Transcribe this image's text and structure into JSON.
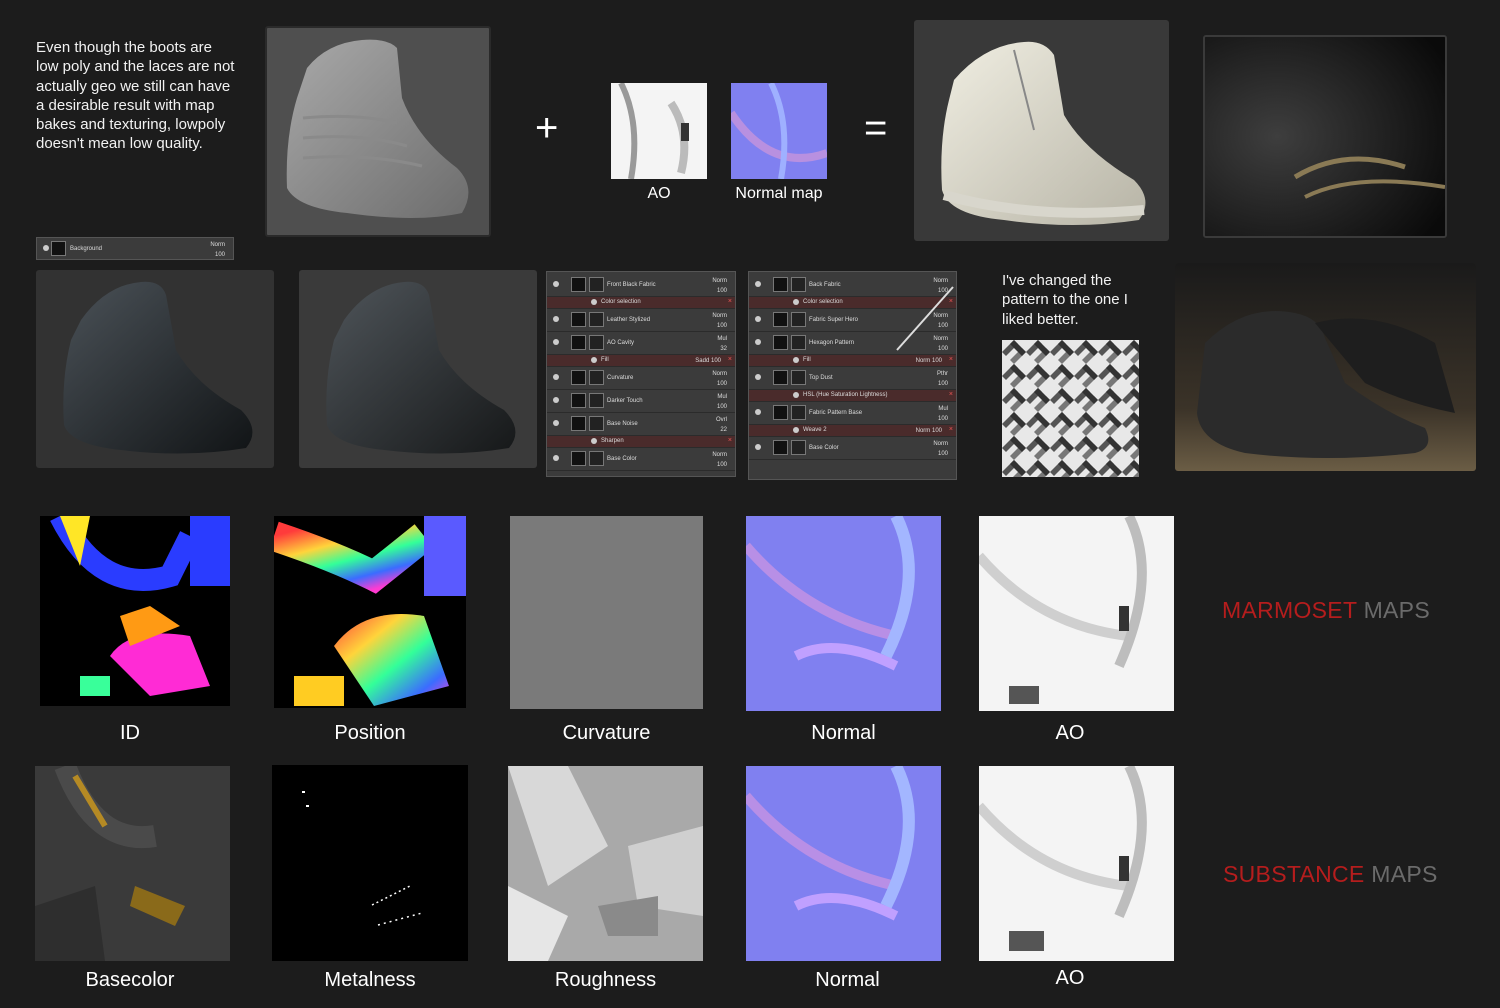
{
  "intro_text": "Even though the boots are low poly and the laces are not actually geo we still can have a desirable result with map bakes and texturing, lowpoly doesn't mean low quality.",
  "operators": {
    "plus": "+",
    "equals": "="
  },
  "top_maps": {
    "ao_label": "AO",
    "normal_label": "Normal map"
  },
  "background_layer": {
    "name": "Background",
    "blend": "Norm",
    "opacity": "100"
  },
  "panel_left": [
    {
      "type": "layer",
      "name": "Front Black Fabric",
      "blend": "Norm",
      "opacity": "100"
    },
    {
      "type": "sub",
      "name": "Color selection",
      "blend": "",
      "opacity": ""
    },
    {
      "type": "layer",
      "name": "Leather Stylized",
      "blend": "Norm",
      "opacity": "100"
    },
    {
      "type": "layer",
      "name": "AO Cavity",
      "blend": "Mul",
      "opacity": "32"
    },
    {
      "type": "sub",
      "name": "Fill",
      "blend": "Sadd",
      "opacity": "100"
    },
    {
      "type": "layer",
      "name": "Curvature",
      "blend": "Norm",
      "opacity": "100"
    },
    {
      "type": "layer",
      "name": "Darker Touch",
      "blend": "Mul",
      "opacity": "100"
    },
    {
      "type": "layer",
      "name": "Base Noise",
      "blend": "Ovrl",
      "opacity": "22"
    },
    {
      "type": "sub",
      "name": "Sharpen",
      "blend": "",
      "opacity": ""
    },
    {
      "type": "layer",
      "name": "Base Color",
      "blend": "Norm",
      "opacity": "100"
    }
  ],
  "panel_right": [
    {
      "type": "layer",
      "name": "Back Fabric",
      "blend": "Norm",
      "opacity": "100"
    },
    {
      "type": "sub",
      "name": "Color selection",
      "blend": "",
      "opacity": ""
    },
    {
      "type": "layer",
      "name": "Fabric Super Hero",
      "blend": "Norm",
      "opacity": "100"
    },
    {
      "type": "layer",
      "name": "Hexagon Pattern",
      "blend": "Norm",
      "opacity": "100"
    },
    {
      "type": "sub",
      "name": "Fill",
      "blend": "Norm",
      "opacity": "100"
    },
    {
      "type": "layer",
      "name": "Top Dust",
      "blend": "Pthr",
      "opacity": "100"
    },
    {
      "type": "sub",
      "name": "HSL (Hue Saturation Lightness)",
      "blend": "",
      "opacity": ""
    },
    {
      "type": "layer",
      "name": "Fabric Pattern Base",
      "blend": "Mul",
      "opacity": "100"
    },
    {
      "type": "sub",
      "name": "Weave 2",
      "blend": "Norm",
      "opacity": "100"
    },
    {
      "type": "layer",
      "name": "Base Color",
      "blend": "Norm",
      "opacity": "100"
    }
  ],
  "pattern_note": "I've changed the pattern to the one I liked better.",
  "marmoset_maps": [
    "ID",
    "Position",
    "Curvature",
    "Normal",
    "AO"
  ],
  "substance_maps": [
    "Basecolor",
    "Metalness",
    "Roughness",
    "Normal",
    "AO"
  ],
  "headings": {
    "marmoset_red": "MARMOSET",
    "marmoset_gray": "MAPS",
    "substance_red": "SUBSTANCE",
    "substance_gray": "MAPS"
  },
  "colors": {
    "heading_red": "#b51d1d",
    "heading_gray": "#6b6b6b",
    "background": "#1c1c1c"
  }
}
